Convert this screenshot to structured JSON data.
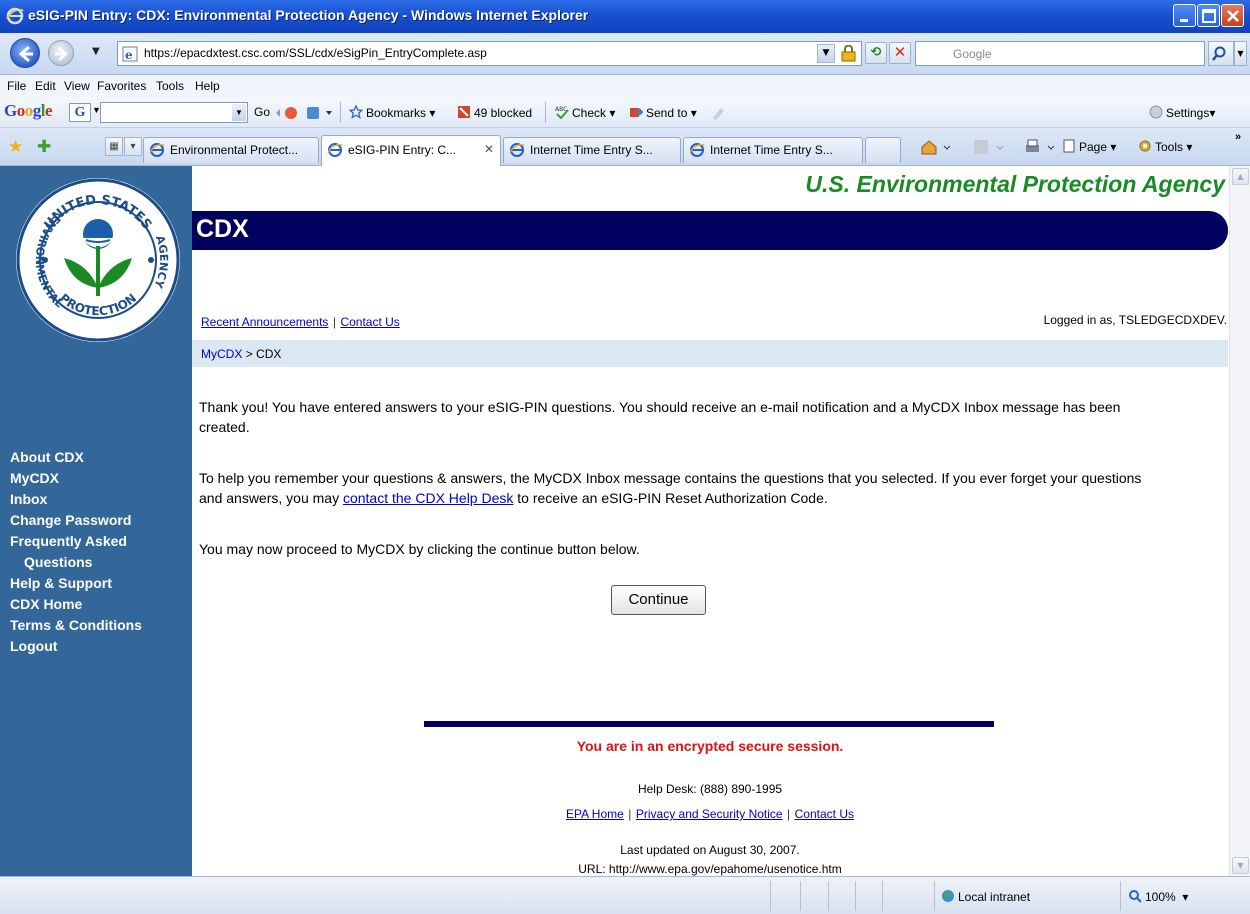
{
  "window": {
    "title": "eSIG-PIN Entry: CDX: Environmental Protection Agency - Windows Internet Explorer"
  },
  "address": {
    "url": "https://epacdxtest.csc.com/SSL/cdx/eSigPin_EntryComplete.asp",
    "search_placeholder": "Google"
  },
  "menu": [
    "File",
    "Edit",
    "View",
    "Favorites",
    "Tools",
    "Help"
  ],
  "google_toolbar": {
    "logo": "Google",
    "go": "Go",
    "bookmarks": "Bookmarks",
    "blocked": "49 blocked",
    "check": "Check",
    "send_to": "Send to",
    "settings": "Settings"
  },
  "tabs": [
    {
      "label": "Environmental Protect..."
    },
    {
      "label": "eSIG-PIN Entry: C...",
      "active": true
    },
    {
      "label": "Internet Time Entry S..."
    },
    {
      "label": "Internet Time Entry S..."
    }
  ],
  "commands": {
    "page": "Page",
    "tools": "Tools"
  },
  "sidebar": {
    "seal_text": {
      "top": "UNITED STATES",
      "left": "ENVIRONMENTAL",
      "right": "AGENCY",
      "bottom": "PROTECTION"
    },
    "nav": [
      "About CDX",
      "MyCDX",
      "Inbox",
      "Change Password",
      "Frequently Asked",
      "Questions",
      "Help & Support",
      "CDX Home",
      "Terms & Conditions",
      "Logout"
    ]
  },
  "header": {
    "agency": "U.S. Environmental Protection Agency",
    "cdx": "CDX",
    "recent_announcements": "Recent Announcements",
    "link_sep": "|",
    "contact_us": "Contact Us",
    "logged_in": "Logged in as, TSLEDGECDXDEV."
  },
  "breadcrumb": {
    "link": "MyCDX",
    "sep": ">",
    "current": "CDX"
  },
  "body": {
    "para1": "Thank you! You have entered answers to your eSIG-PIN questions. You should receive an e-mail notification and a MyCDX Inbox message has been created.",
    "para2_a": "To help you remember your questions & answers, the MyCDX Inbox message contains the questions that you selected. If you ever forget your questions and answers, you may ",
    "para2_link": "contact the CDX Help Desk",
    "para2_b": " to receive an eSIG-PIN Reset Authorization Code.",
    "para3": "You may now proceed to MyCDX by clicking the continue button below.",
    "continue": "Continue"
  },
  "footer": {
    "secure": "You are in an encrypted secure session.",
    "helpdesk": "Help Desk: (888) 890-1995",
    "links": [
      "EPA Home",
      "Privacy and Security Notice",
      "Contact Us"
    ],
    "sep": "|",
    "updated": "Last updated on August 30, 2007.",
    "url": "URL: http://www.epa.gov/epahome/usenotice.htm"
  },
  "status": {
    "zone": "Local intranet",
    "zoom": "100%"
  },
  "colors": {
    "sidebar": "#336699",
    "cdx_bar": "#00005f",
    "agency_green": "#1a8a25",
    "secure_red": "#e01010",
    "link_blue": "#0000cc"
  }
}
